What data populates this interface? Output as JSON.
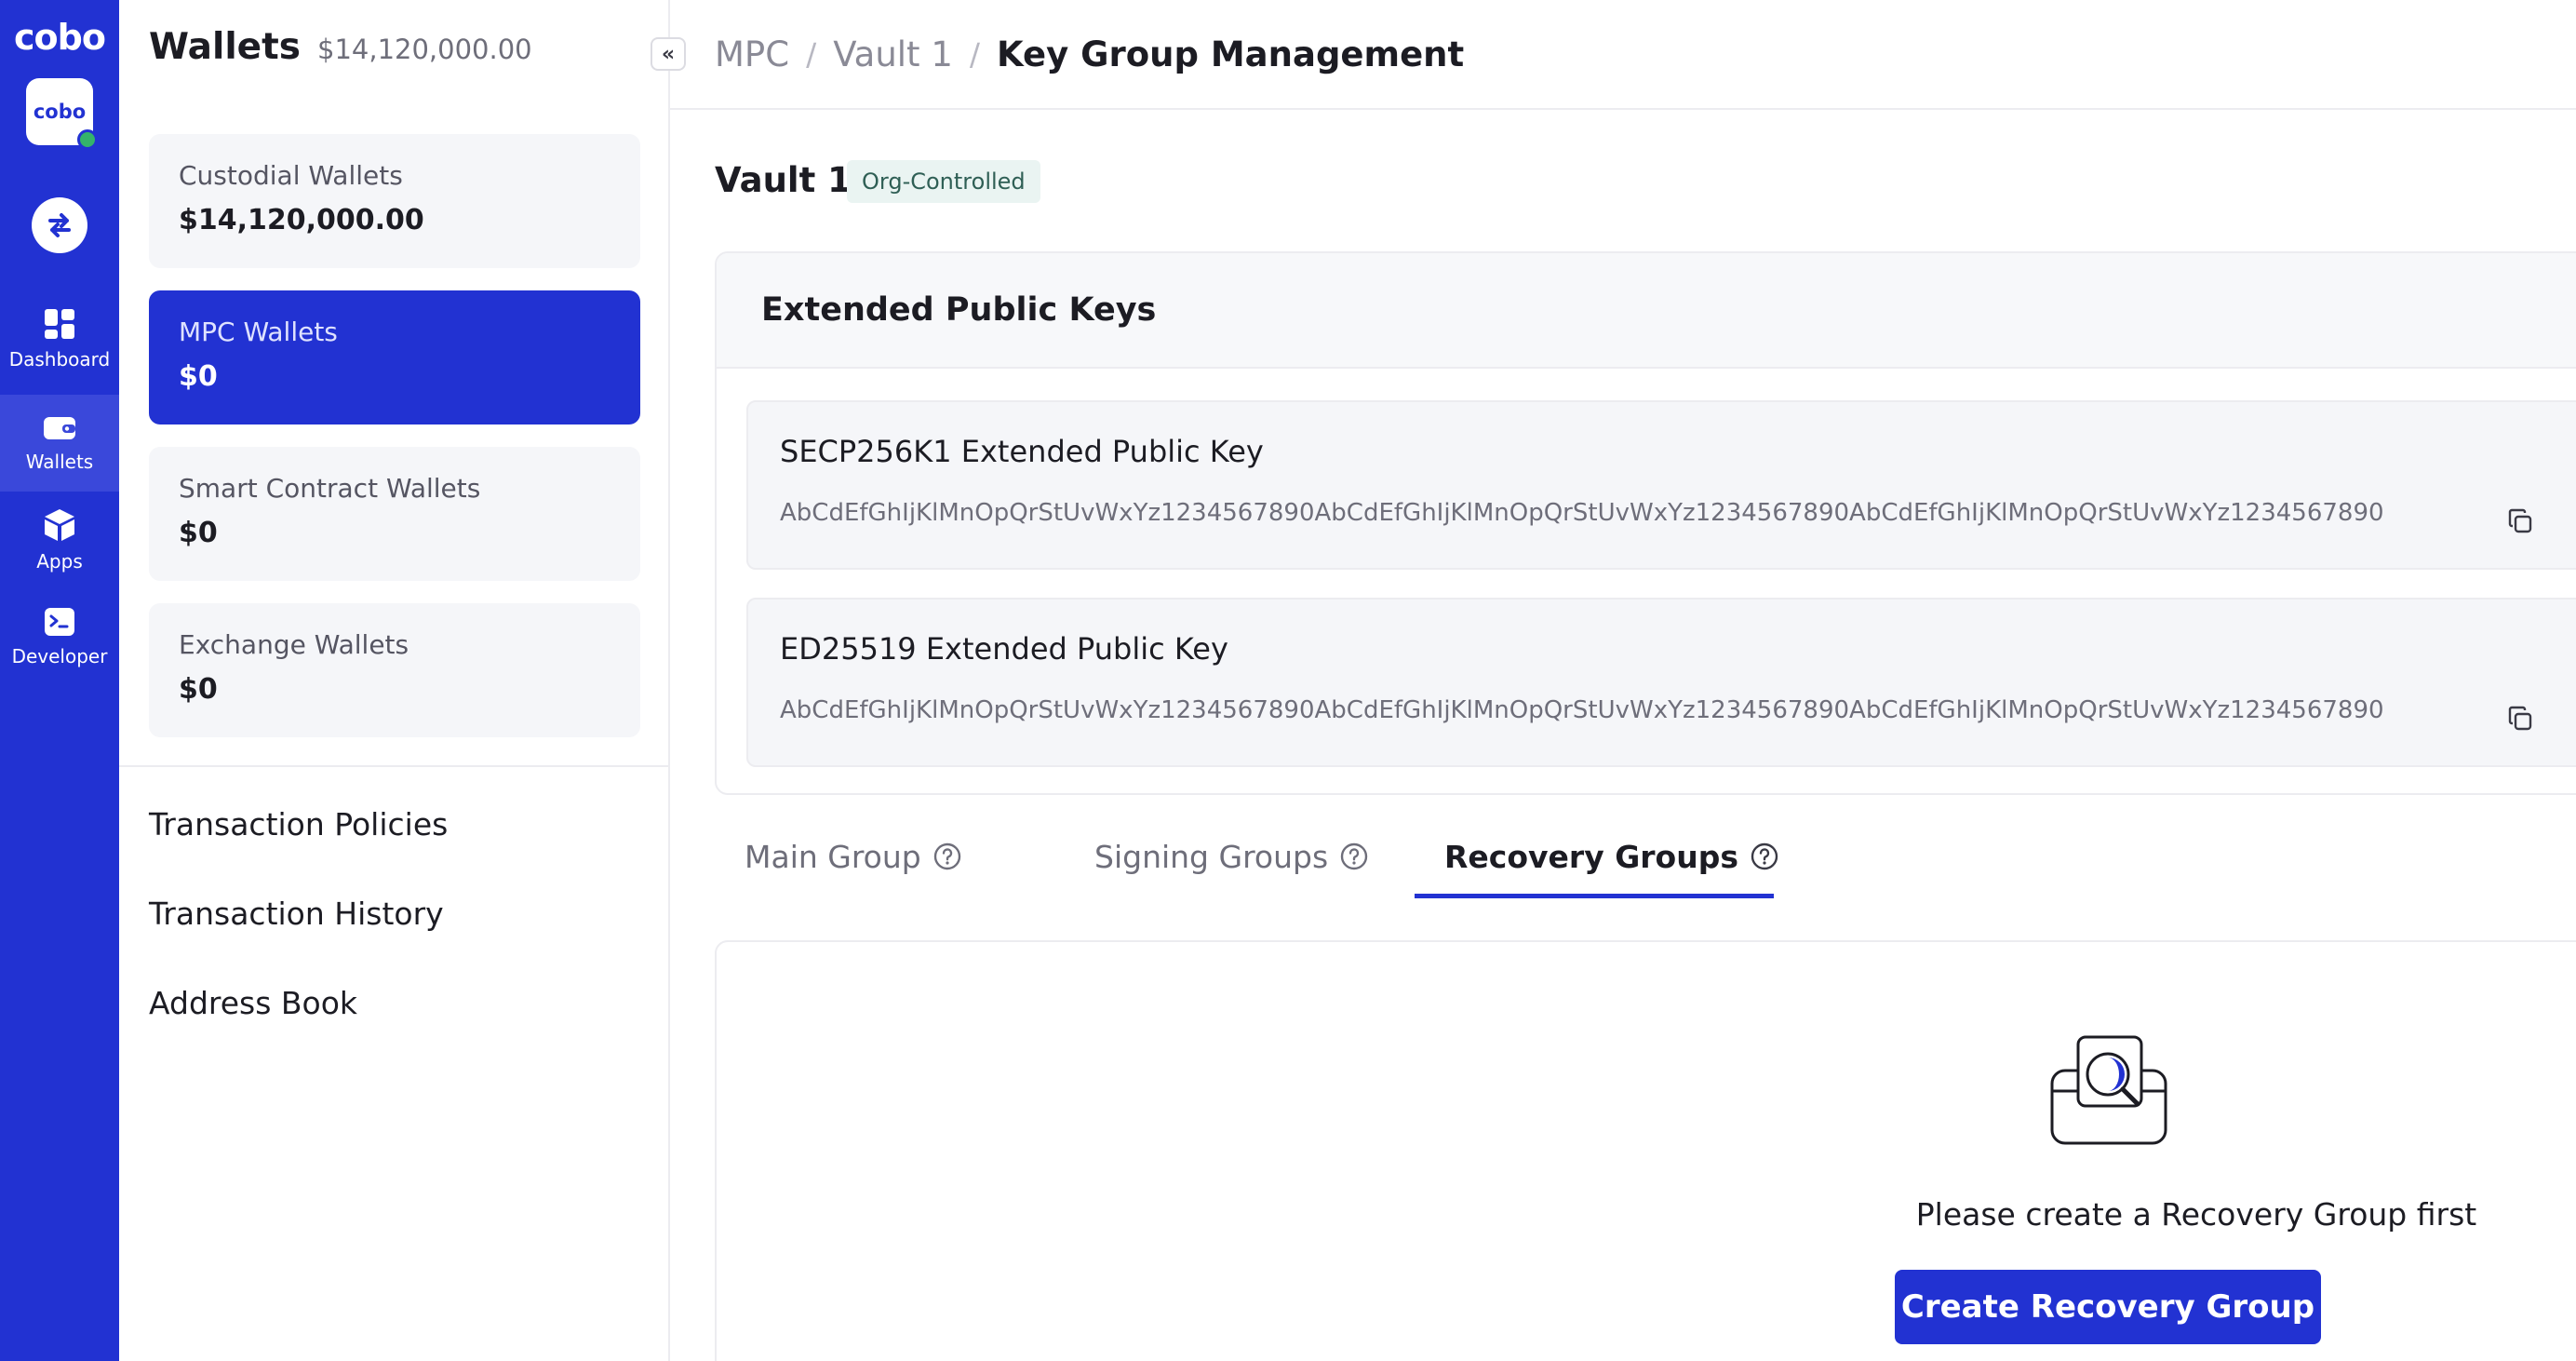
{
  "rail": {
    "logo": "cobo",
    "app_badge": "cobo",
    "items": [
      {
        "label": "Dashboard",
        "icon": "grid-icon"
      },
      {
        "label": "Wallets",
        "icon": "wallet-icon"
      },
      {
        "label": "Apps",
        "icon": "cube-icon"
      },
      {
        "label": "Developer",
        "icon": "terminal-icon"
      }
    ],
    "active": "Wallets"
  },
  "panel": {
    "title": "Wallets",
    "total": "$14,120,000.00",
    "wallets": [
      {
        "name": "Custodial Wallets",
        "amount": "$14,120,000.00"
      },
      {
        "name": "MPC Wallets",
        "amount": "$0"
      },
      {
        "name": "Smart Contract Wallets",
        "amount": "$0"
      },
      {
        "name": "Exchange Wallets",
        "amount": "$0"
      }
    ],
    "active_wallet": "MPC Wallets",
    "links": [
      "Transaction Policies",
      "Transaction History",
      "Address Book"
    ]
  },
  "breadcrumb": {
    "items": [
      "MPC",
      "Vault 1"
    ],
    "current": "Key Group Management",
    "separator": "/"
  },
  "vault": {
    "name": "Vault 1",
    "badge": "Org-Controlled"
  },
  "keys": {
    "title": "Extended Public Keys",
    "items": [
      {
        "label": "SECP256K1 Extended Public Key",
        "value": "AbCdEfGhIjKlMnOpQrStUvWxYz1234567890AbCdEfGhIjKlMnOpQrStUvWxYz1234567890AbCdEfGhIjKlMnOpQrStUvWxYz1234567890"
      },
      {
        "label": "ED25519 Extended Public Key",
        "value": "AbCdEfGhIjKlMnOpQrStUvWxYz1234567890AbCdEfGhIjKlMnOpQrStUvWxYz1234567890AbCdEfGhIjKlMnOpQrStUvWxYz1234567890"
      }
    ]
  },
  "tabs": {
    "items": [
      "Main Group",
      "Signing Groups",
      "Recovery Groups"
    ],
    "active": "Recovery Groups"
  },
  "empty_state": {
    "message": "Please create a Recovery Group first",
    "button": "Create Recovery Group"
  },
  "colors": {
    "brand": "#2232d2",
    "badge_bg": "#eaf4f2",
    "status_online": "#34b36b"
  }
}
